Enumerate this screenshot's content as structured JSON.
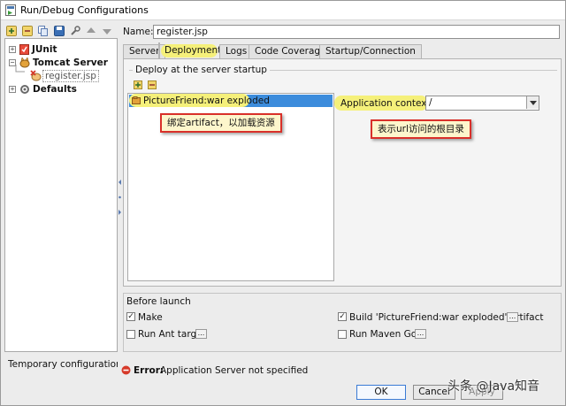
{
  "window": {
    "title": "Run/Debug Configurations"
  },
  "toolbar": {
    "icons": [
      "add-icon",
      "remove-icon",
      "copy-icon",
      "save-icon",
      "wrench-icon",
      "move-up-icon",
      "move-down-icon"
    ]
  },
  "tree": {
    "items": [
      {
        "label": "JUnit",
        "icon": "junit-icon"
      },
      {
        "label": "Tomcat Server",
        "icon": "tomcat-icon"
      },
      {
        "label": "register.jsp",
        "icon": "tomcat-config-error-icon"
      },
      {
        "label": "Defaults",
        "icon": "defaults-icon"
      }
    ]
  },
  "name_field": {
    "label": "Name:",
    "value": "register.jsp"
  },
  "tabs": [
    {
      "label": "Server",
      "active": false
    },
    {
      "label": "Deployment",
      "active": true
    },
    {
      "label": "Logs",
      "active": false
    },
    {
      "label": "Code Coverage",
      "active": false
    },
    {
      "label": "Startup/Connection",
      "active": false
    }
  ],
  "deployment": {
    "group_title": "Deploy at the server startup",
    "artifacts": [
      "PictureFriend:war exploded"
    ],
    "context_label": "Application context:",
    "context_value": "/"
  },
  "annotations": {
    "artifact_note": "绑定artifact，以加载资源",
    "context_note": "表示url访问的根目录"
  },
  "before_launch": {
    "title": "Before launch",
    "items": [
      {
        "label": "Make",
        "checked": true
      },
      {
        "label": "Build 'PictureFriend:war exploded' artifact",
        "checked": true
      },
      {
        "label": "Run Ant target",
        "checked": false
      },
      {
        "label": "Run Maven Goal",
        "checked": false
      }
    ],
    "ellipsis": "..."
  },
  "footer": {
    "temp_config_text": "Temporary configurations lin",
    "error_prefix": "Error:",
    "error_text": "Application Server not specified",
    "ok_label": "OK",
    "cancel_label": "Cancel",
    "third_button_label": "Apply",
    "watermark": "头条 @Java知音"
  },
  "colors": {
    "selection": "#3c8cdc",
    "highlight": "#f5f07a",
    "annotation_border": "#d9302a",
    "annotation_bg": "#fdf6cc",
    "error_icon": "#d63a2a"
  }
}
